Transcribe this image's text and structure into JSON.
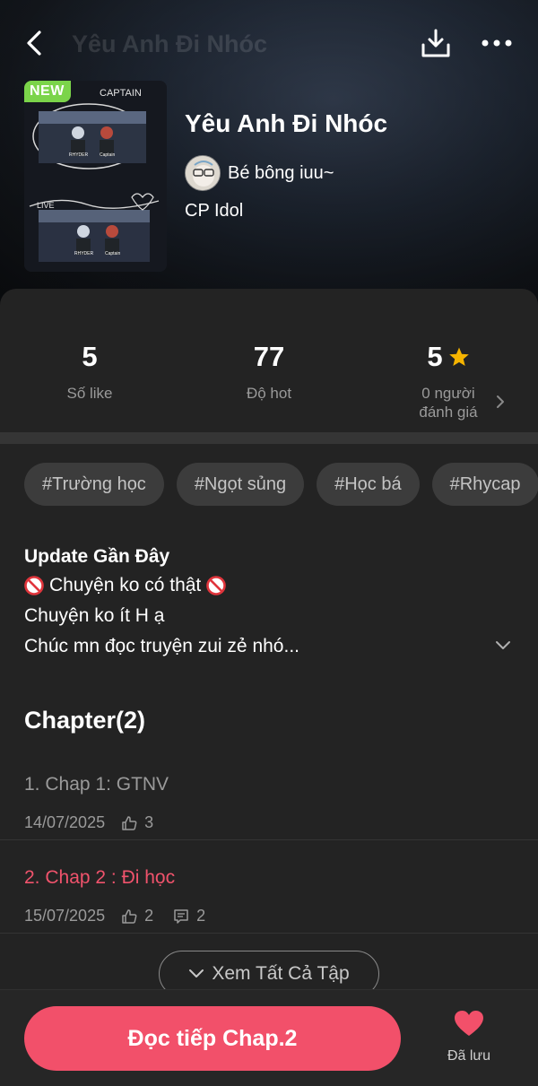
{
  "header": {
    "ghost_title": "Yêu Anh Đi Nhóc",
    "badge": "NEW",
    "title": "Yêu Anh Đi Nhóc",
    "author": "Bé bông iuu~",
    "category": "CP Idol",
    "cover_texts": [
      "CAPTAIN",
      "LIVE",
      "RHYDER",
      "Captain",
      "RHYDER",
      "Captain"
    ]
  },
  "stats": {
    "likes": {
      "value": "5",
      "label": "Số like"
    },
    "hot": {
      "value": "77",
      "label": "Độ hot"
    },
    "rating": {
      "value": "5",
      "label_line1": "0 người",
      "label_line2": "đánh giá"
    }
  },
  "tags": [
    "#Trường học",
    "#Ngọt sủng",
    "#Học bá",
    "#Rhycap"
  ],
  "description": {
    "heading": "Update Gần Đây",
    "line1": "Chuyện ko có thật",
    "line2": "Chuyện ko ít H ạ",
    "line3": "Chúc mn đọc truyện zui zẻ nhó..."
  },
  "chapters": {
    "title": "Chapter(2)",
    "items": [
      {
        "name": "1. Chap 1: GTNV",
        "date": "14/07/2025",
        "likes": "3"
      },
      {
        "name": "2. Chap 2 : Đi học",
        "date": "15/07/2025",
        "likes": "2",
        "comments": "2"
      }
    ],
    "see_all": "Xem Tất Cả Tập"
  },
  "bottom": {
    "read_label": "Đọc tiếp Chap.2",
    "saved_label": "Đã lưu"
  },
  "colors": {
    "accent": "#f2506a",
    "new_badge": "#7bd44a",
    "star": "#f5b400",
    "background": "#232323"
  },
  "icons": [
    "back-arrow-icon",
    "download-icon",
    "more-icon",
    "star-icon",
    "chevron-right-icon",
    "no-entry-icon",
    "chevron-down-icon",
    "thumbs-up-icon",
    "comment-icon",
    "heart-icon"
  ]
}
